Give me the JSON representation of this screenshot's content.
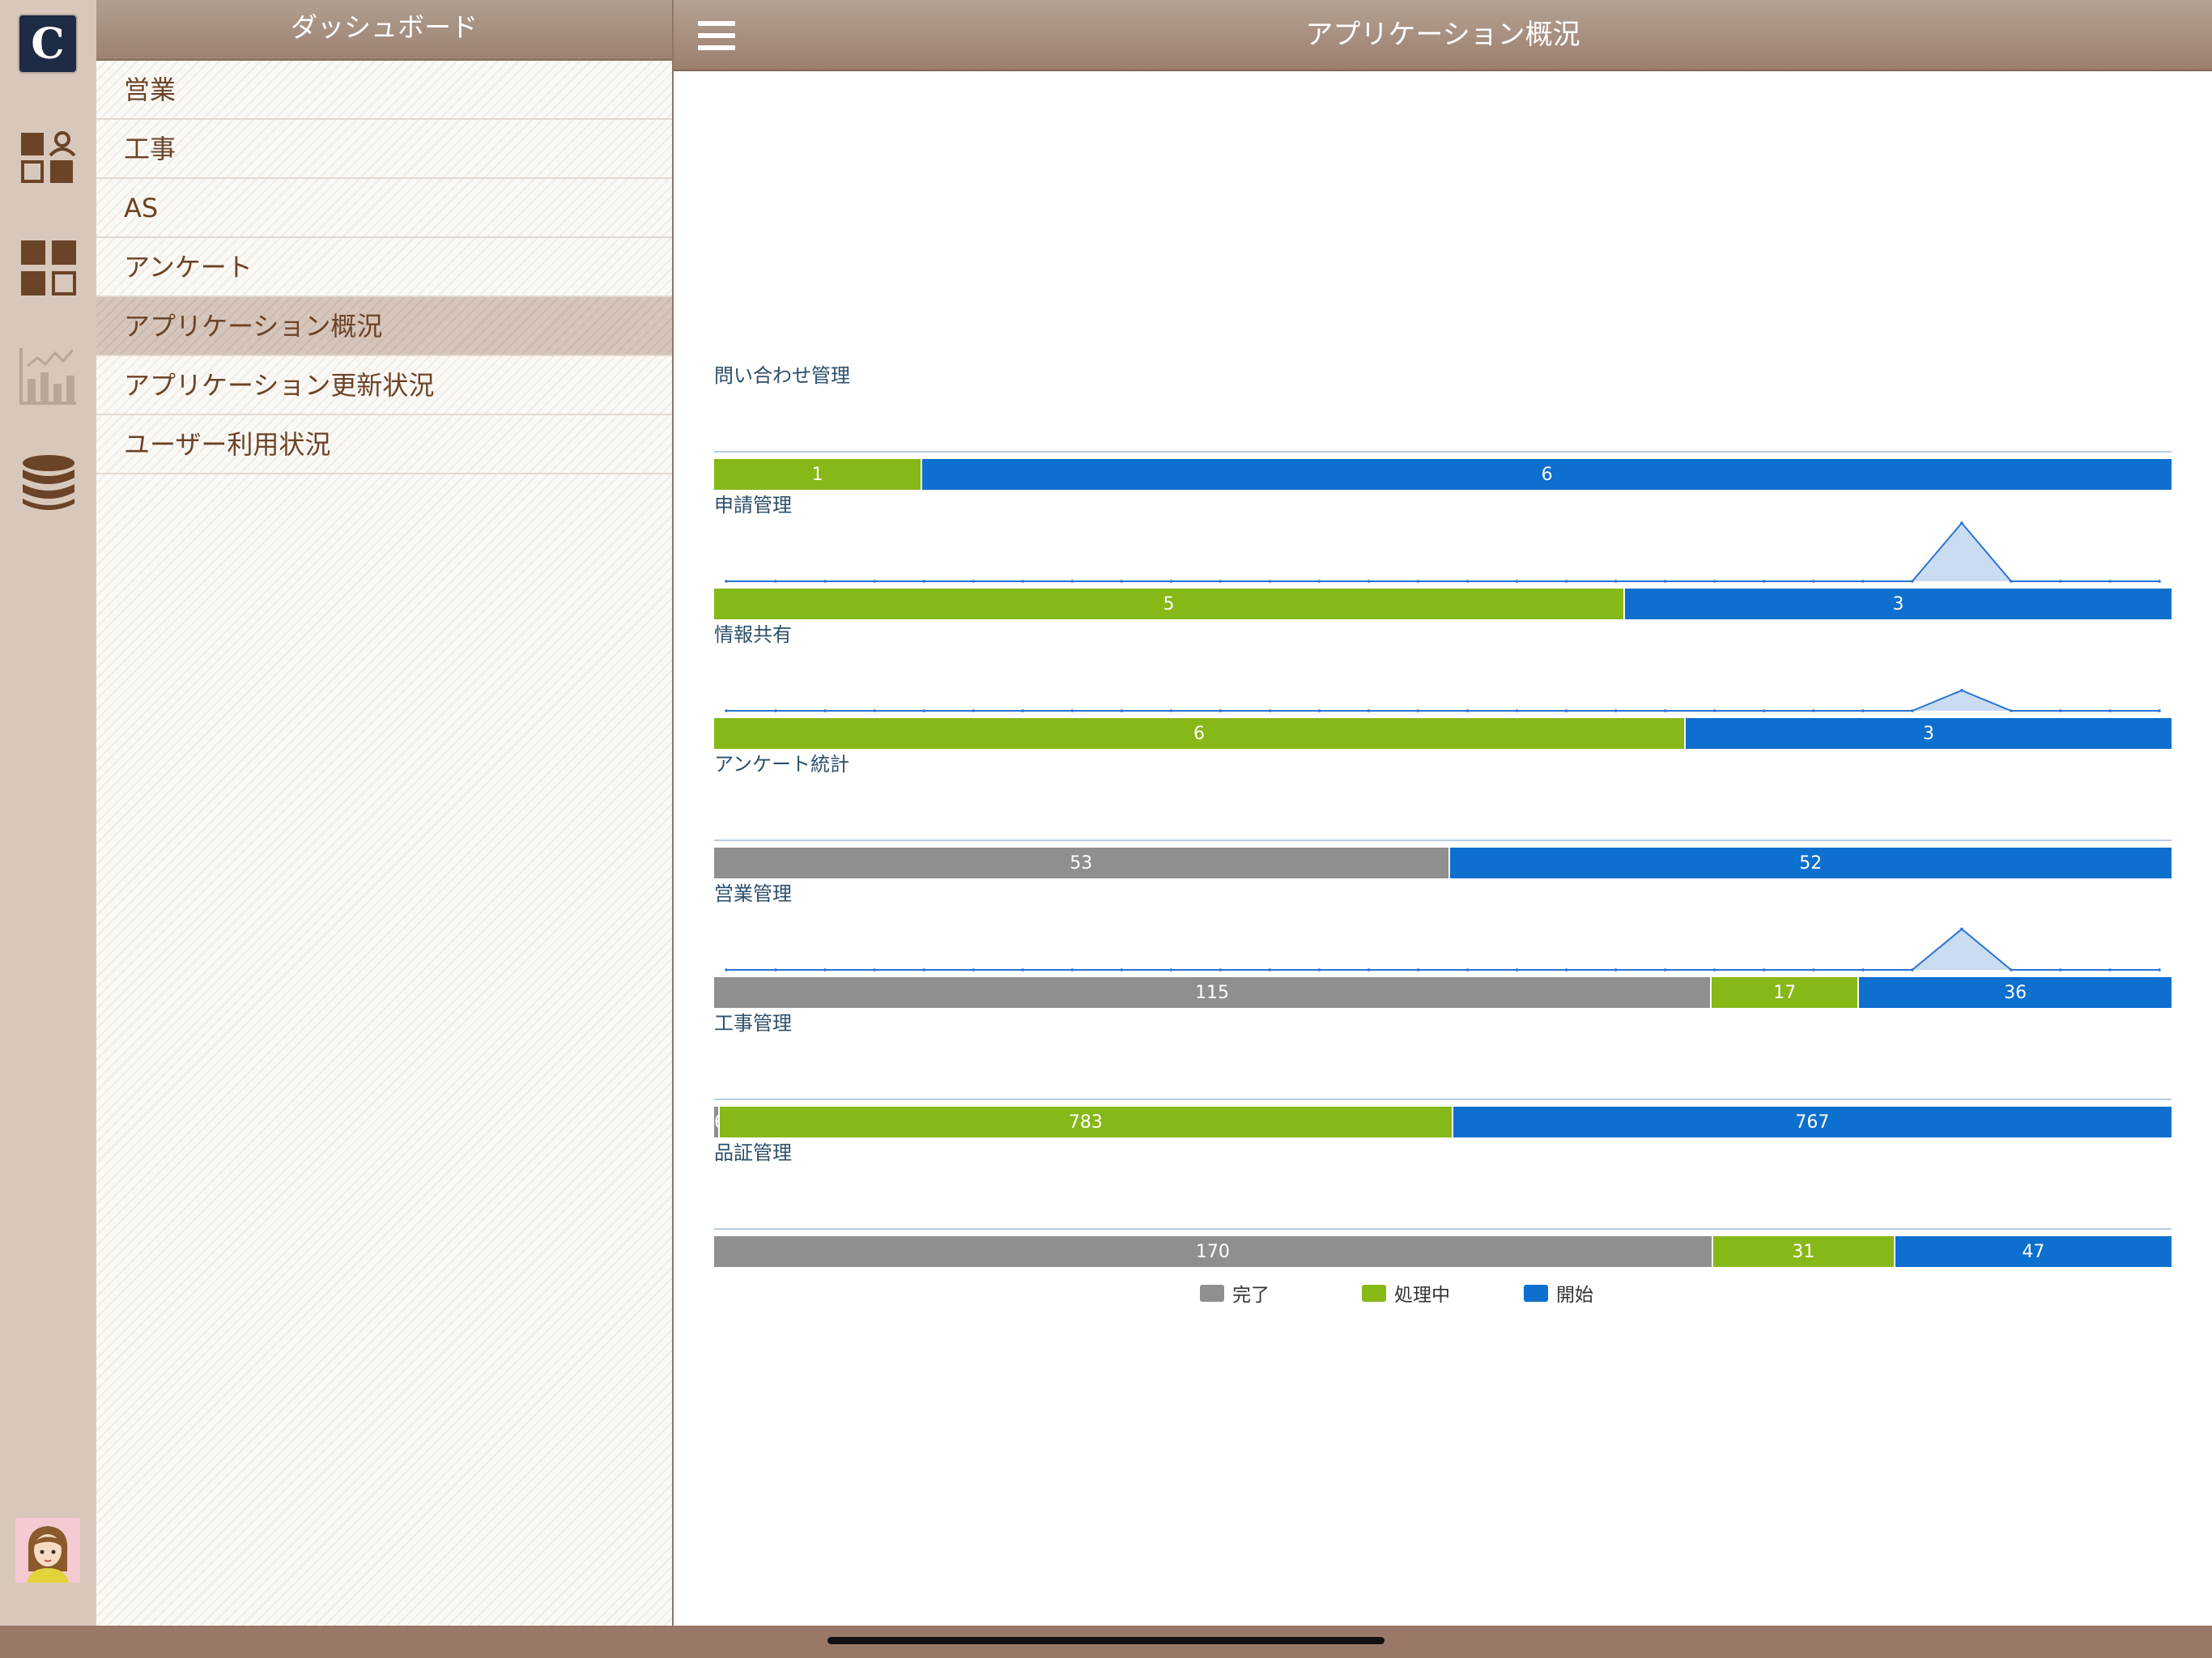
{
  "sidebar_header": "ダッシュボード",
  "menu_items": [
    {
      "label": "営業"
    },
    {
      "label": "工事"
    },
    {
      "label": "AS"
    },
    {
      "label": "アンケート"
    },
    {
      "label": "アプリケーション概況",
      "selected": true
    },
    {
      "label": "アプリケーション更新状況"
    },
    {
      "label": "ユーザー利用状況"
    }
  ],
  "rail_icons": [
    "user-dashboard-icon",
    "grid-icon",
    "chart-icon",
    "database-icon"
  ],
  "app_logo": "C",
  "main_title": "アプリケーション概況",
  "colors": {
    "done": "#8f8f8f",
    "processing": "#86b818",
    "started": "#0d6fce",
    "spark": "#2a73d4"
  },
  "chart_data": {
    "type": "bar",
    "stacked": true,
    "orientation": "horizontal",
    "legend_position": "bottom",
    "series_names": [
      "完了",
      "処理中",
      "開始"
    ],
    "rows": [
      {
        "name": "問い合わせ管理",
        "values": [
          0,
          1,
          6
        ],
        "spark": null
      },
      {
        "name": "申請管理",
        "values": [
          0,
          5,
          3
        ],
        "spark": [
          0,
          0,
          0,
          0,
          0,
          0,
          0,
          0,
          0,
          0,
          0,
          0,
          0,
          0,
          0,
          0,
          0,
          0,
          0,
          0,
          0,
          0,
          0,
          0,
          0,
          1,
          0,
          0,
          0,
          0
        ]
      },
      {
        "name": "情報共有",
        "values": [
          0,
          6,
          3
        ],
        "spark": [
          0,
          0,
          0,
          0,
          0,
          0,
          0,
          0,
          0,
          0,
          0,
          0,
          0,
          0,
          0,
          0,
          0,
          0,
          0,
          0,
          0,
          0,
          0,
          0,
          0,
          0.35,
          0,
          0,
          0,
          0
        ]
      },
      {
        "name": "アンケート統計",
        "values": [
          53,
          0,
          52
        ],
        "spark": null
      },
      {
        "name": "営業管理",
        "values": [
          115,
          17,
          36
        ],
        "spark": [
          0,
          0,
          0,
          0,
          0,
          0,
          0,
          0,
          0,
          0,
          0,
          0,
          0,
          0,
          0,
          0,
          0,
          0,
          0,
          0,
          0,
          0,
          0,
          0,
          0,
          0.7,
          0,
          0,
          0,
          0
        ]
      },
      {
        "name": "工事管理",
        "values": [
          6,
          783,
          767
        ],
        "spark": null
      },
      {
        "name": "品証管理",
        "values": [
          170,
          31,
          47
        ],
        "spark": null
      }
    ]
  }
}
